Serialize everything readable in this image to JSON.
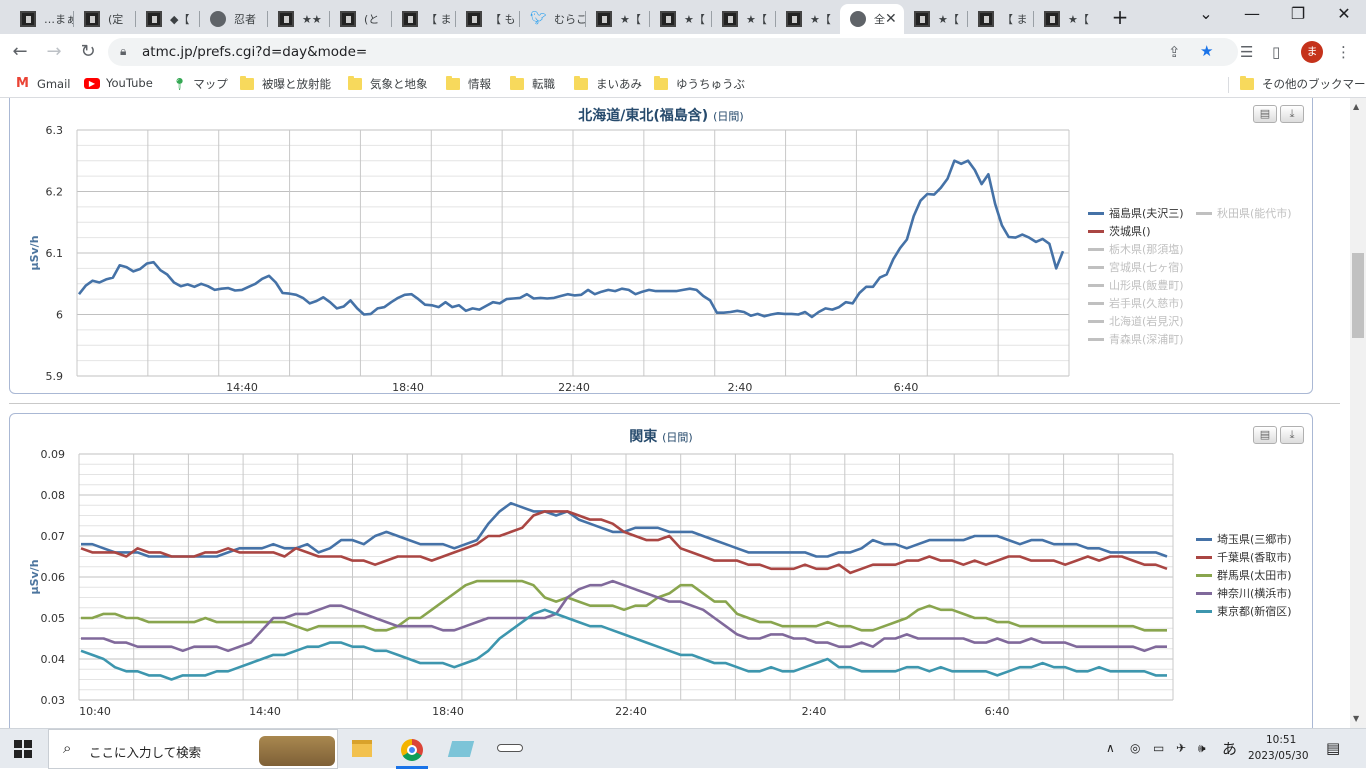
{
  "browser": {
    "tabs": [
      {
        "label": "…まぁ",
        "icon": "site-icon"
      },
      {
        "label": "(定",
        "icon": "site-icon"
      },
      {
        "label": "◆【",
        "icon": "site-icon"
      },
      {
        "label": "忍者",
        "icon": "globe-icon"
      },
      {
        "label": "★★",
        "icon": "site-icon"
      },
      {
        "label": "(と",
        "icon": "site-icon"
      },
      {
        "label": "【 ま",
        "icon": "site-icon"
      },
      {
        "label": "【 も",
        "icon": "site-icon"
      },
      {
        "label": "むらこ",
        "icon": "twitter-icon"
      },
      {
        "label": "★【",
        "icon": "site-icon"
      },
      {
        "label": "★【",
        "icon": "site-icon"
      },
      {
        "label": "★【",
        "icon": "site-icon"
      },
      {
        "label": "★【",
        "icon": "site-icon"
      },
      {
        "label": "全",
        "icon": "globe-icon"
      },
      {
        "label": "★【",
        "icon": "site-icon"
      },
      {
        "label": "【 ま",
        "icon": "site-icon"
      },
      {
        "label": "★【",
        "icon": "site-icon"
      }
    ],
    "active_tab_index": 13,
    "new_tab": "+",
    "url": "atmc.jp/prefs.cgi?d=day&mode=",
    "avatar_letter": "ま",
    "bookmarks": [
      {
        "label": "Gmail",
        "icon": "gmail-icon"
      },
      {
        "label": "YouTube",
        "icon": "youtube-icon"
      },
      {
        "label": "マップ",
        "icon": "maps-icon"
      },
      {
        "label": "被曝と放射能",
        "icon": "folder-icon"
      },
      {
        "label": "気象と地象",
        "icon": "folder-icon"
      },
      {
        "label": "情報",
        "icon": "folder-icon"
      },
      {
        "label": "転職",
        "icon": "folder-icon"
      },
      {
        "label": "まいあみ",
        "icon": "folder-icon"
      },
      {
        "label": "ゆうちゅうぶ",
        "icon": "folder-icon"
      }
    ],
    "other_bookmarks": "その他のブックマーク"
  },
  "chart_data": [
    {
      "type": "line",
      "title": "北海道/東北(福島含)",
      "subtitle": "(日間)",
      "ylabel": "µSv/h",
      "ylim": [
        5.9,
        6.3
      ],
      "yticks": [
        "6.3",
        "6.2",
        "6.1",
        "6",
        "5.9"
      ],
      "xticks": [
        "14:40",
        "18:40",
        "22:40",
        "2:40",
        "6:40"
      ],
      "series": [
        {
          "name": "福島県(夫沢三)",
          "color": "#4572a7",
          "active": true,
          "values": [
            6.033,
            6.047,
            6.055,
            6.052,
            6.057,
            6.06,
            6.08,
            6.077,
            6.07,
            6.074,
            6.083,
            6.085,
            6.072,
            6.065,
            6.052,
            6.046,
            6.049,
            6.045,
            6.05,
            6.046,
            6.04,
            6.042,
            6.043,
            6.039,
            6.04,
            6.045,
            6.05,
            6.058,
            6.063,
            6.052,
            6.035,
            6.034,
            6.032,
            6.027,
            6.018,
            6.022,
            6.028,
            6.02,
            6.01,
            6.013,
            6.023,
            6.01,
            6.0,
            6.001,
            6.01,
            6.012,
            6.02,
            6.027,
            6.032,
            6.033,
            6.025,
            6.016,
            6.015,
            6.012,
            6.02,
            6.012,
            6.015,
            6.006,
            6.01,
            6.008,
            6.014,
            6.02,
            6.018,
            6.025,
            6.026,
            6.027,
            6.033,
            6.026,
            6.027,
            6.026,
            6.027,
            6.03,
            6.033,
            6.031,
            6.032,
            6.04,
            6.033,
            6.037,
            6.04,
            6.038,
            6.042,
            6.04,
            6.033,
            6.037,
            6.04,
            6.038,
            6.038,
            6.038,
            6.038,
            6.04,
            6.042,
            6.04,
            6.03,
            6.023,
            6.003,
            6.003,
            6.004,
            6.006,
            6.004,
            5.998,
            6.001,
            5.997,
            6.0,
            6.002,
            6.001,
            6.001,
            6.0,
            6.004,
            5.996,
            6.004,
            6.01,
            6.008,
            6.012,
            6.02,
            6.018,
            6.035,
            6.045,
            6.045,
            6.06,
            6.065,
            6.09,
            6.108,
            6.122,
            6.16,
            6.185,
            6.196,
            6.195,
            6.206,
            6.221,
            6.25,
            6.245,
            6.25,
            6.235,
            6.212,
            6.228,
            6.18,
            6.145,
            6.126,
            6.125,
            6.13,
            6.125,
            6.118,
            6.123,
            6.115,
            6.075,
            6.103
          ]
        },
        {
          "name": "茨城県()",
          "color": "#aa4643",
          "active": true,
          "values": []
        },
        {
          "name": "秋田県(能代市)",
          "color": "#c0c0c0",
          "active": false,
          "values": []
        },
        {
          "name": "栃木県(那須塩)",
          "color": "#c0c0c0",
          "active": false,
          "values": []
        },
        {
          "name": "宮城県(七ヶ宿)",
          "color": "#c0c0c0",
          "active": false,
          "values": []
        },
        {
          "name": "山形県(飯豊町)",
          "color": "#c0c0c0",
          "active": false,
          "values": []
        },
        {
          "name": "岩手県(久慈市)",
          "color": "#c0c0c0",
          "active": false,
          "values": []
        },
        {
          "name": "北海道(岩見沢)",
          "color": "#c0c0c0",
          "active": false,
          "values": []
        },
        {
          "name": "青森県(深浦町)",
          "color": "#c0c0c0",
          "active": false,
          "values": []
        }
      ]
    },
    {
      "type": "line",
      "title": "関東",
      "subtitle": "(日間)",
      "ylabel": "µSv/h",
      "ylim": [
        0.03,
        0.09
      ],
      "yticks": [
        "0.09",
        "0.08",
        "0.07",
        "0.06",
        "0.05",
        "0.04",
        "0.03"
      ],
      "xticks": [
        "10:40",
        "14:40",
        "18:40",
        "22:40",
        "2:40",
        "6:40"
      ],
      "series": [
        {
          "name": "埼玉県(三郷市)",
          "color": "#4572a7",
          "active": true,
          "values": [
            0.068,
            0.068,
            0.067,
            0.066,
            0.066,
            0.066,
            0.065,
            0.065,
            0.065,
            0.065,
            0.065,
            0.065,
            0.065,
            0.066,
            0.067,
            0.067,
            0.067,
            0.068,
            0.067,
            0.067,
            0.068,
            0.066,
            0.067,
            0.069,
            0.069,
            0.068,
            0.07,
            0.071,
            0.07,
            0.069,
            0.068,
            0.068,
            0.068,
            0.067,
            0.068,
            0.069,
            0.073,
            0.076,
            0.078,
            0.077,
            0.076,
            0.076,
            0.075,
            0.076,
            0.074,
            0.073,
            0.072,
            0.071,
            0.071,
            0.072,
            0.072,
            0.072,
            0.071,
            0.071,
            0.071,
            0.07,
            0.069,
            0.068,
            0.067,
            0.066,
            0.066,
            0.066,
            0.066,
            0.066,
            0.066,
            0.065,
            0.065,
            0.066,
            0.066,
            0.067,
            0.069,
            0.068,
            0.068,
            0.067,
            0.068,
            0.069,
            0.069,
            0.069,
            0.069,
            0.07,
            0.07,
            0.07,
            0.069,
            0.068,
            0.069,
            0.069,
            0.068,
            0.068,
            0.068,
            0.067,
            0.067,
            0.066,
            0.066,
            0.066,
            0.066,
            0.066,
            0.065
          ]
        },
        {
          "name": "千葉県(香取市)",
          "color": "#aa4643",
          "active": true,
          "values": [
            0.067,
            0.066,
            0.066,
            0.066,
            0.065,
            0.067,
            0.066,
            0.066,
            0.065,
            0.065,
            0.065,
            0.066,
            0.066,
            0.067,
            0.066,
            0.066,
            0.066,
            0.066,
            0.065,
            0.067,
            0.066,
            0.065,
            0.065,
            0.065,
            0.064,
            0.064,
            0.063,
            0.064,
            0.065,
            0.065,
            0.065,
            0.064,
            0.065,
            0.066,
            0.067,
            0.068,
            0.07,
            0.07,
            0.071,
            0.072,
            0.075,
            0.076,
            0.076,
            0.076,
            0.075,
            0.074,
            0.074,
            0.073,
            0.071,
            0.07,
            0.069,
            0.069,
            0.07,
            0.067,
            0.066,
            0.065,
            0.064,
            0.064,
            0.064,
            0.063,
            0.063,
            0.062,
            0.062,
            0.062,
            0.063,
            0.062,
            0.062,
            0.063,
            0.061,
            0.062,
            0.063,
            0.063,
            0.063,
            0.064,
            0.064,
            0.065,
            0.064,
            0.064,
            0.063,
            0.064,
            0.063,
            0.064,
            0.065,
            0.065,
            0.064,
            0.064,
            0.064,
            0.063,
            0.064,
            0.065,
            0.064,
            0.065,
            0.065,
            0.064,
            0.063,
            0.063,
            0.062
          ]
        },
        {
          "name": "群馬県(太田市)",
          "color": "#89a54e",
          "active": true,
          "values": [
            0.05,
            0.05,
            0.051,
            0.051,
            0.05,
            0.05,
            0.049,
            0.049,
            0.049,
            0.049,
            0.049,
            0.05,
            0.049,
            0.049,
            0.049,
            0.049,
            0.049,
            0.049,
            0.049,
            0.048,
            0.047,
            0.048,
            0.048,
            0.048,
            0.048,
            0.048,
            0.047,
            0.047,
            0.048,
            0.05,
            0.05,
            0.052,
            0.054,
            0.056,
            0.058,
            0.059,
            0.059,
            0.059,
            0.059,
            0.059,
            0.058,
            0.055,
            0.054,
            0.055,
            0.054,
            0.053,
            0.053,
            0.053,
            0.052,
            0.053,
            0.053,
            0.055,
            0.056,
            0.058,
            0.058,
            0.056,
            0.054,
            0.054,
            0.051,
            0.05,
            0.049,
            0.049,
            0.048,
            0.048,
            0.048,
            0.048,
            0.049,
            0.048,
            0.048,
            0.047,
            0.047,
            0.048,
            0.049,
            0.05,
            0.052,
            0.053,
            0.052,
            0.052,
            0.051,
            0.05,
            0.05,
            0.049,
            0.049,
            0.048,
            0.048,
            0.048,
            0.048,
            0.048,
            0.048,
            0.048,
            0.048,
            0.048,
            0.048,
            0.048,
            0.047,
            0.047,
            0.047
          ]
        },
        {
          "name": "神奈川(横浜市)",
          "color": "#80699b",
          "active": true,
          "values": [
            0.045,
            0.045,
            0.045,
            0.044,
            0.044,
            0.043,
            0.043,
            0.043,
            0.043,
            0.042,
            0.043,
            0.043,
            0.043,
            0.042,
            0.043,
            0.044,
            0.047,
            0.05,
            0.05,
            0.051,
            0.051,
            0.052,
            0.053,
            0.053,
            0.052,
            0.051,
            0.05,
            0.049,
            0.048,
            0.048,
            0.048,
            0.048,
            0.047,
            0.047,
            0.048,
            0.049,
            0.05,
            0.05,
            0.05,
            0.05,
            0.05,
            0.05,
            0.051,
            0.055,
            0.057,
            0.058,
            0.058,
            0.059,
            0.058,
            0.057,
            0.056,
            0.055,
            0.054,
            0.054,
            0.053,
            0.052,
            0.05,
            0.048,
            0.046,
            0.045,
            0.045,
            0.046,
            0.046,
            0.045,
            0.045,
            0.044,
            0.044,
            0.043,
            0.043,
            0.044,
            0.043,
            0.045,
            0.045,
            0.046,
            0.045,
            0.045,
            0.045,
            0.045,
            0.045,
            0.044,
            0.044,
            0.045,
            0.044,
            0.044,
            0.045,
            0.044,
            0.044,
            0.044,
            0.043,
            0.043,
            0.043,
            0.043,
            0.043,
            0.043,
            0.042,
            0.043,
            0.043
          ]
        },
        {
          "name": "東京都(新宿区)",
          "color": "#3d96ae",
          "active": true,
          "values": [
            0.042,
            0.041,
            0.04,
            0.038,
            0.037,
            0.037,
            0.036,
            0.036,
            0.035,
            0.036,
            0.036,
            0.036,
            0.037,
            0.037,
            0.038,
            0.039,
            0.04,
            0.041,
            0.041,
            0.042,
            0.043,
            0.043,
            0.044,
            0.044,
            0.043,
            0.043,
            0.042,
            0.042,
            0.041,
            0.04,
            0.039,
            0.039,
            0.039,
            0.038,
            0.039,
            0.04,
            0.042,
            0.045,
            0.047,
            0.049,
            0.051,
            0.052,
            0.051,
            0.05,
            0.049,
            0.048,
            0.048,
            0.047,
            0.046,
            0.045,
            0.044,
            0.043,
            0.042,
            0.041,
            0.041,
            0.04,
            0.039,
            0.039,
            0.038,
            0.037,
            0.037,
            0.038,
            0.037,
            0.037,
            0.038,
            0.039,
            0.04,
            0.038,
            0.038,
            0.037,
            0.037,
            0.037,
            0.037,
            0.038,
            0.038,
            0.037,
            0.038,
            0.037,
            0.037,
            0.037,
            0.037,
            0.036,
            0.037,
            0.038,
            0.038,
            0.039,
            0.038,
            0.038,
            0.037,
            0.037,
            0.038,
            0.037,
            0.037,
            0.037,
            0.037,
            0.036,
            0.036
          ]
        }
      ]
    }
  ],
  "taskbar": {
    "search_placeholder": "ここに入力して検索",
    "time": "10:51",
    "date": "2023/05/30",
    "ime": "あ"
  }
}
